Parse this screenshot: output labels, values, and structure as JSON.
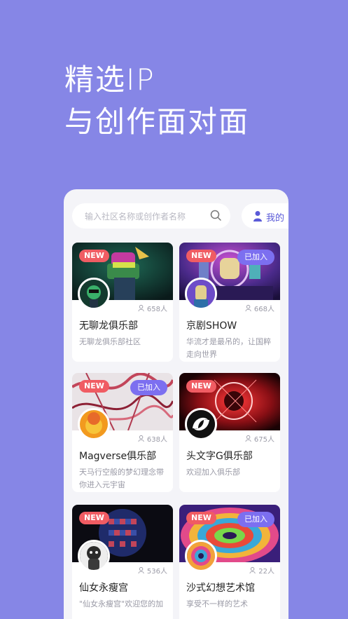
{
  "headline": {
    "line1": "精选IP",
    "line2": "与创作面对面"
  },
  "search": {
    "placeholder": "输入社区名称或创作者名称",
    "icon": "search-icon"
  },
  "mine": {
    "label": "我的",
    "icon": "user-icon"
  },
  "cards": [
    {
      "name": "无聊龙俱乐部",
      "desc": "无聊龙俱乐部社区",
      "members": "658人",
      "new": "NEW",
      "joined": ""
    },
    {
      "name": "京剧SHOW",
      "desc": "华流才是最吊的，让国粹走向世界",
      "members": "668人",
      "new": "NEW",
      "joined": "已加入"
    },
    {
      "name": "Magverse俱乐部",
      "desc": "天马行空般的梦幻理念带你进入元宇宙",
      "members": "638人",
      "new": "NEW",
      "joined": "已加入"
    },
    {
      "name": "头文字G俱乐部",
      "desc": "欢迎加入俱乐部",
      "members": "675人",
      "new": "NEW",
      "joined": ""
    },
    {
      "name": "仙女永瘦宫",
      "desc": "\"仙女永瘦宫\"欢迎您的加",
      "members": "536人",
      "new": "NEW",
      "joined": ""
    },
    {
      "name": "沙式幻想艺术馆",
      "desc": "享受不一样的艺术",
      "members": "22人",
      "new": "NEW",
      "joined": "已加入"
    }
  ],
  "colors": {
    "background": "#8686e6",
    "accent": "#7c6ff0",
    "new_badge": "#f05c63"
  }
}
